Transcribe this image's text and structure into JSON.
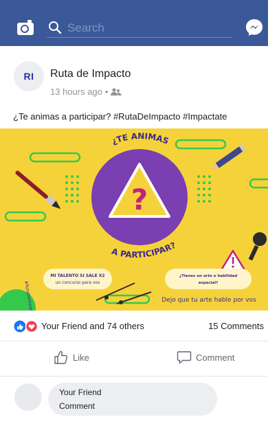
{
  "header": {
    "search_placeholder": "Search"
  },
  "post": {
    "avatar_initials": "RI",
    "page_name": "Ruta de Impacto",
    "time": "13 hours ago",
    "caption": "¿Te animas a participar? #RutaDeImpacto #Impactate",
    "image": {
      "top_text": "¿TE ANIMAS",
      "bottom_text": "A PARTICIPAR?",
      "question_mark": "?",
      "left_card_line1": "MI TALENTO SI SALE X2",
      "left_card_line2": "un concurso para vos",
      "right_card_line1": "¿Tienes un arte o habilidad",
      "right_card_line2": "especial?",
      "right_caption": "Dejo que tu arte hable por vos",
      "side_tag": "#RutaDeImpacto",
      "colors": {
        "background": "#f6d23a",
        "circle": "#7a3fb0",
        "accent_green": "#35c94b",
        "magenta": "#c0257a"
      }
    },
    "reactions": {
      "text": "Your Friend and 74 others",
      "comments": "15 Comments"
    },
    "actions": {
      "like": "Like",
      "comment": "Comment"
    },
    "comment_preview": {
      "name": "Your Friend",
      "text": "Comment"
    }
  },
  "colors": {
    "header": "#3b5998",
    "like_blue": "#1877f2",
    "love_red": "#f33e58"
  }
}
